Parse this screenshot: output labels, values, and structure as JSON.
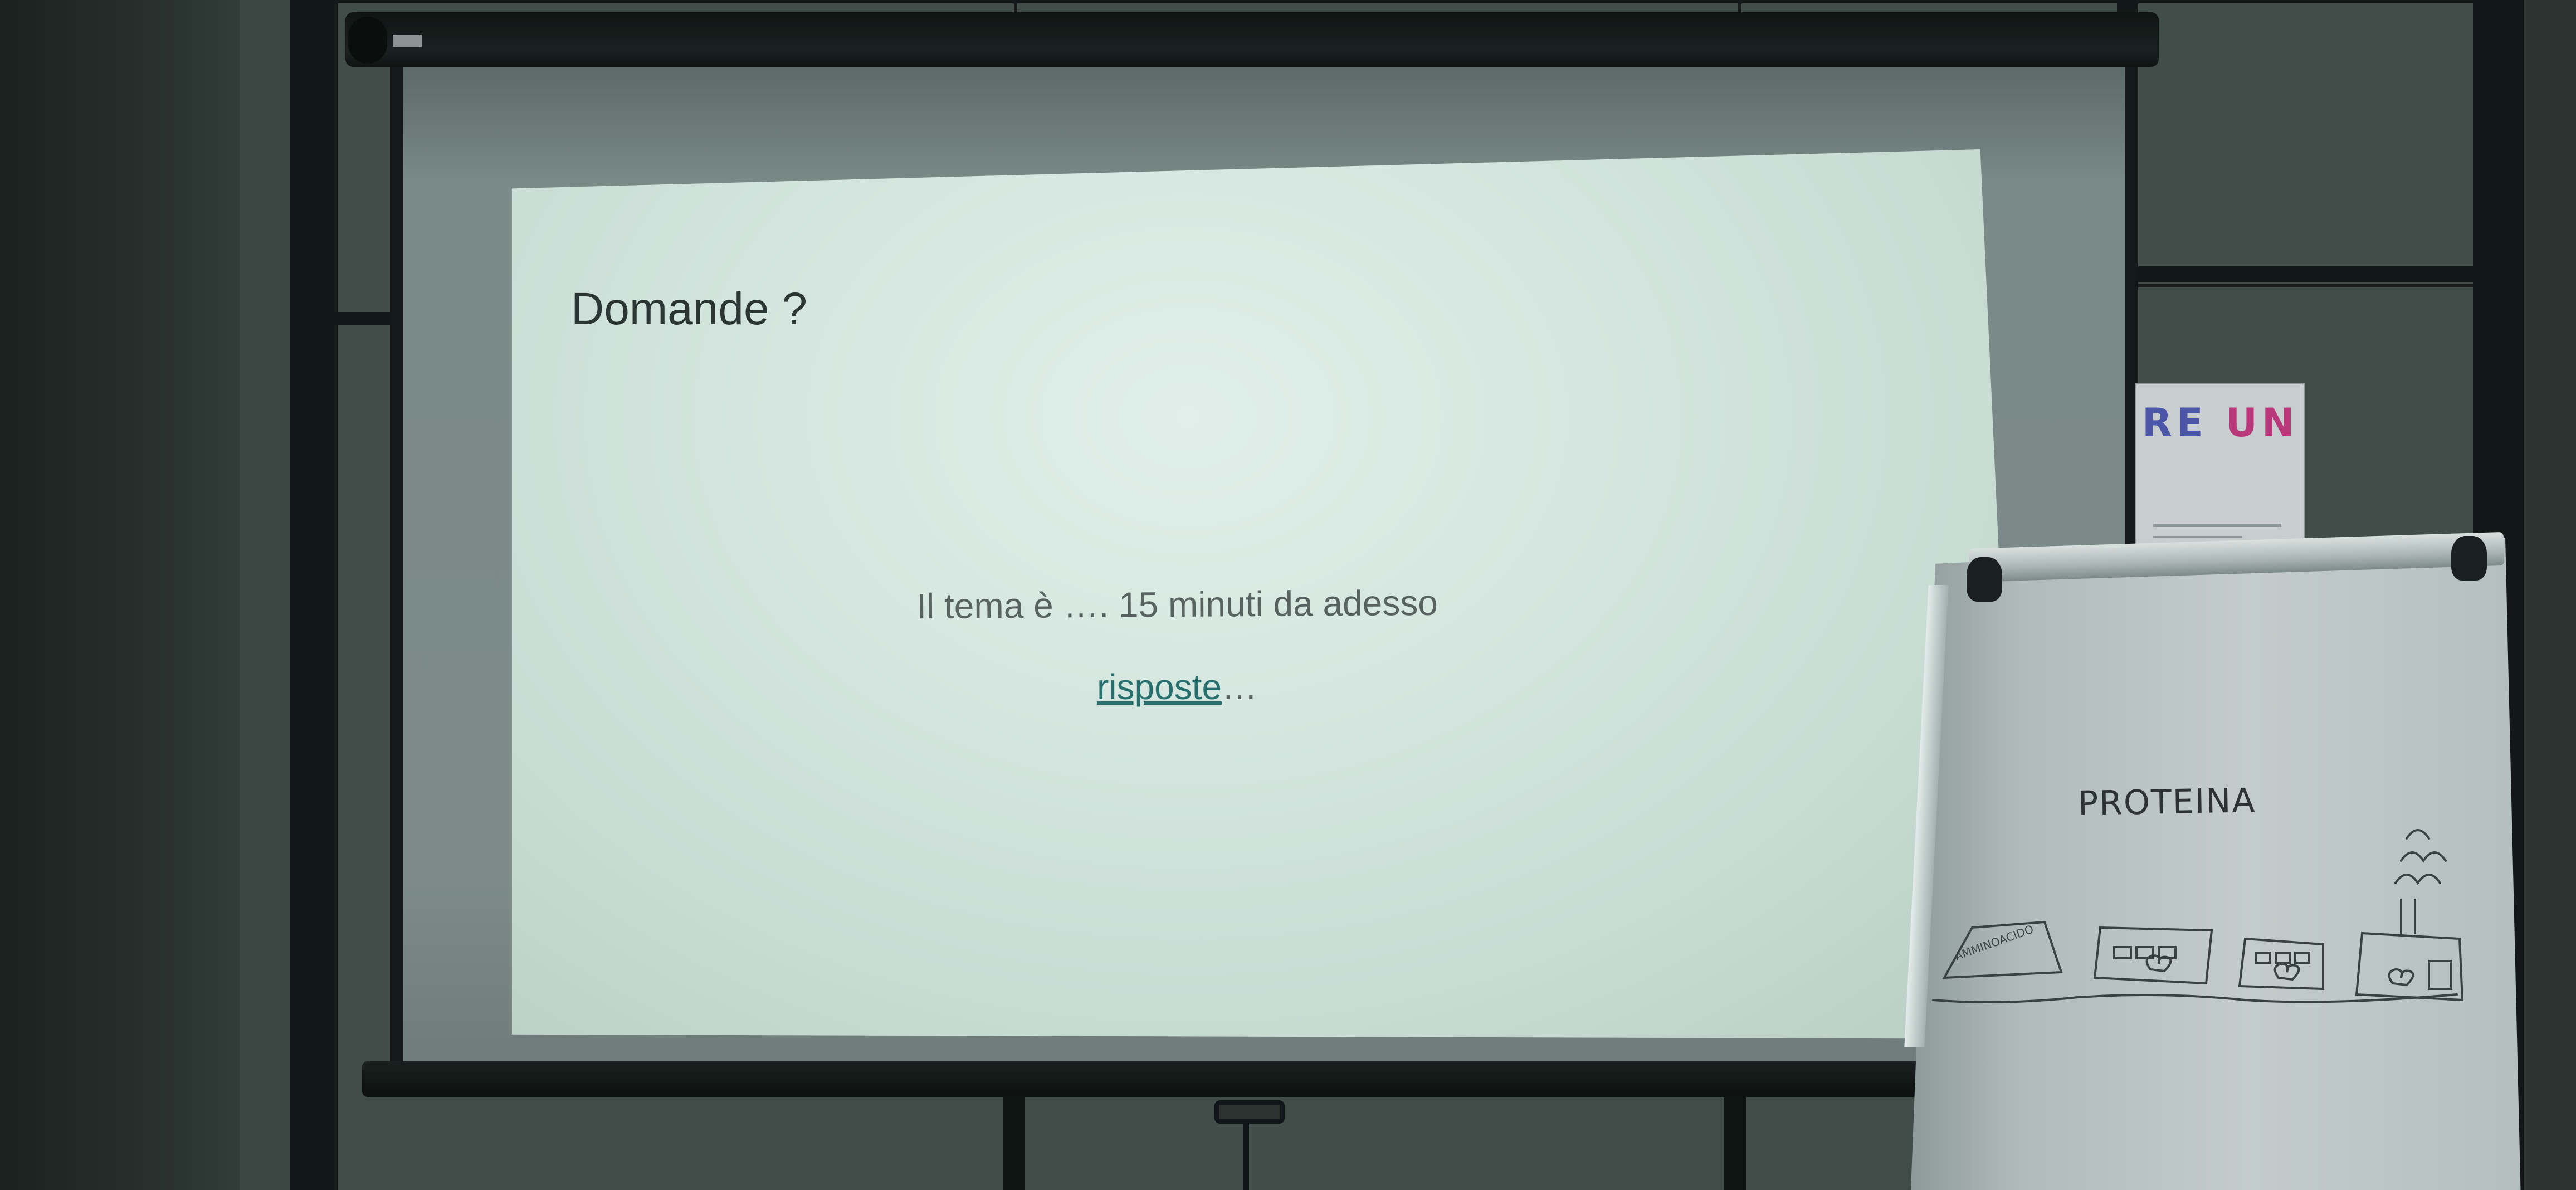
{
  "slide": {
    "title": "Domande ?",
    "body": "Il tema è …. 15 minuti da adesso",
    "link": "risposte",
    "link_suffix": "…"
  },
  "poster": {
    "part1": "RE",
    "part2": "UN"
  },
  "flipchart": {
    "heading": "PROTEINA",
    "label": "AMMINOACIDO"
  }
}
